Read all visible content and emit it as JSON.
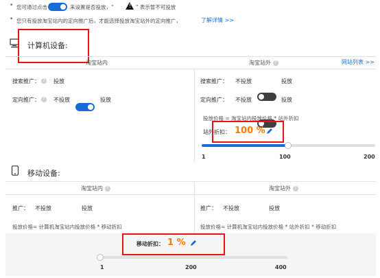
{
  "top_hints": {
    "line1_prefix": "您可通过点击",
    "line1_middle": "来设置是否投放，\"",
    "line1_suffix": "\" 表示暂不可投放",
    "line2_text": "您只有投放淘宝站内的定向推广后，才能选择投放淘宝站外的定向推广，",
    "line2_link": "了解详情 >>"
  },
  "pc": {
    "title": "计算机设备:",
    "left_header": "淘宝站内",
    "right_header": "淘宝站外",
    "site_list_link": "网站列表 >>",
    "left": {
      "search_label": "搜索推广：",
      "search_value": "投放",
      "targeted_label": "定向推广：",
      "targeted_off": "不投放",
      "targeted_on": "投放"
    },
    "right": {
      "search_label": "搜索推广：",
      "search_off": "不投放",
      "search_on": "投放",
      "targeted_label": "定向推广：",
      "targeted_off": "不投放",
      "targeted_on": "投放",
      "formula": "投放价格 = 淘宝站内投放价格 * 站外折扣",
      "discount_label": "站外折扣：",
      "discount_value": "100 %",
      "slider": {
        "min": "1",
        "mid": "100",
        "max": "200",
        "value": 100
      }
    }
  },
  "mobile": {
    "title": "移动设备:",
    "left_header": "淘宝站内",
    "right_header": "淘宝站外",
    "left": {
      "promo_label": "推广：",
      "promo_off": "不投放",
      "promo_on": "投放",
      "formula": "投放价格= 计算机淘宝站内投放价格 * 移动折扣"
    },
    "right": {
      "promo_label": "推广：",
      "promo_off": "不投放",
      "promo_on": "投放",
      "formula": "投放价格= 计算机淘宝站内投放价格 * 站外折扣 * 移动折扣"
    },
    "discount_label": "移动折扣：",
    "discount_value": "1 %",
    "slider": {
      "min": "1",
      "mid": "200",
      "max": "400",
      "value": 1
    }
  },
  "colors": {
    "toggle_on": "#1b6bd7",
    "toggle_off": "#3f3f3f",
    "accent_orange": "#ff7a00",
    "highlight_red": "#ee1111",
    "link_blue": "#1a73d1"
  },
  "icons": {
    "help": "question-circle-icon",
    "monitor": "monitor-icon",
    "phone": "phone-icon",
    "edit": "pencil-icon",
    "warning": "warning-triangle-icon"
  }
}
